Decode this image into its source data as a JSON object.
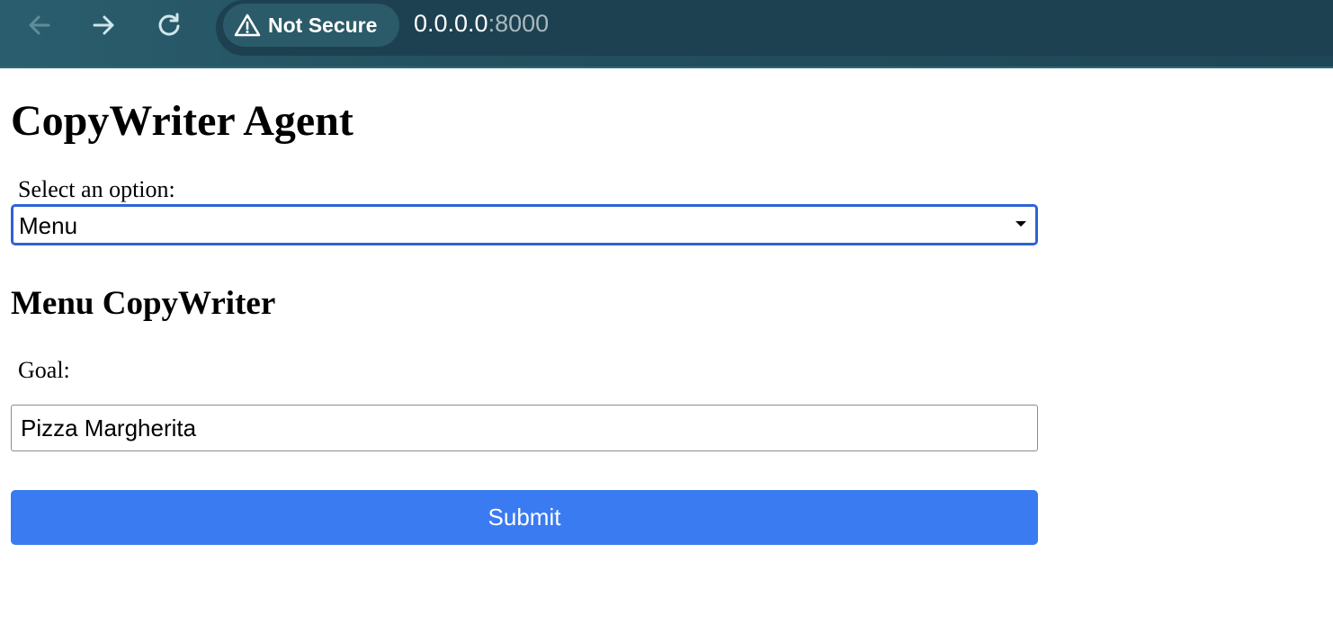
{
  "browser": {
    "security_label": "Not Secure",
    "url_host": "0.0.0.0",
    "url_port": ":8000",
    "icons": {
      "back": "arrow-left-icon",
      "forward": "arrow-right-icon",
      "reload": "reload-icon",
      "security": "warning-triangle-icon"
    },
    "colors": {
      "toolbar": "#24505f",
      "url_host": "#ffffff",
      "url_port": "#a8b9bf"
    }
  },
  "page": {
    "title": "CopyWriter Agent",
    "select_label": "Select an option:",
    "select_value": "Menu",
    "section_title": "Menu CopyWriter",
    "goal_label": "Goal:",
    "goal_value": "Pizza Margherita",
    "submit_label": "Submit",
    "colors": {
      "submit_button": "#3a7bf2",
      "select_focus_border": "#2f63d6"
    }
  }
}
